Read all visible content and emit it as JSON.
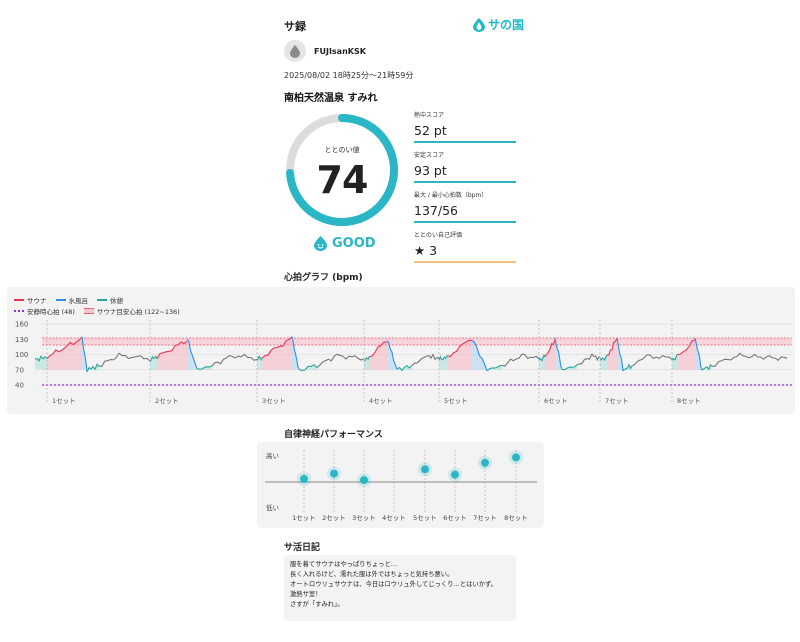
{
  "header": {
    "title": "サ録",
    "brand": "サの国"
  },
  "user": {
    "name": "FUJIsanKSK"
  },
  "session": {
    "datetime": "2025/08/02 18時25分～21時59分",
    "facility": "南柏天然温泉 すみれ"
  },
  "totonoi": {
    "label": "ととのい値",
    "value": "74",
    "value_fraction": 0.74,
    "status": "GOOD"
  },
  "metrics": [
    {
      "label": "熱中スコア",
      "value": "52 pt"
    },
    {
      "label": "安定スコア",
      "value": "93 pt"
    },
    {
      "label": "最大 / 最小心拍数（bpm）",
      "value": "137/56"
    },
    {
      "label": "ととのい自己評価",
      "value": "★ 3"
    }
  ],
  "colors": {
    "accent": "#2bb6c6",
    "sauna": "#e8345a",
    "water": "#2f8fe0",
    "rest": "#26a69a",
    "resting_line": "#8a2be2",
    "rating": "#f4c27c"
  },
  "hr_graph": {
    "title": "心拍グラフ (bpm)",
    "legend": {
      "sauna": "サウナ",
      "water": "水風呂",
      "rest": "休憩",
      "resting": "安静時心拍 (48)",
      "target": "サウナ目安心拍 (122~136)"
    },
    "y_ticks": [
      "160",
      "130",
      "100",
      "70",
      "40"
    ],
    "set_labels": [
      "1セット",
      "2セット",
      "3セット",
      "4セット",
      "5セット",
      "6セット",
      "7セット",
      "8セット"
    ]
  },
  "autonomic": {
    "title": "自律神経パフォーマンス",
    "high_label": "高い",
    "low_label": "低い",
    "set_labels": [
      "1セット",
      "2セット",
      "3セット",
      "4セット",
      "5セット",
      "6セット",
      "7セット",
      "8セット"
    ],
    "levels": [
      0.5,
      0.6,
      0.48,
      null,
      0.68,
      0.58,
      0.8,
      0.9
    ]
  },
  "diary": {
    "title": "サ活日記",
    "lines": [
      "服を着てサウナはやっぱりちょっと…",
      "長く入れるけど、濡れた服は外ではちょっと気持ち悪い。",
      "",
      "オートロウリュサウナは、今日はロウリュ外してじっくり…とはいかず。",
      "激熱サ室！",
      "さすが「すみれ」。"
    ]
  }
}
